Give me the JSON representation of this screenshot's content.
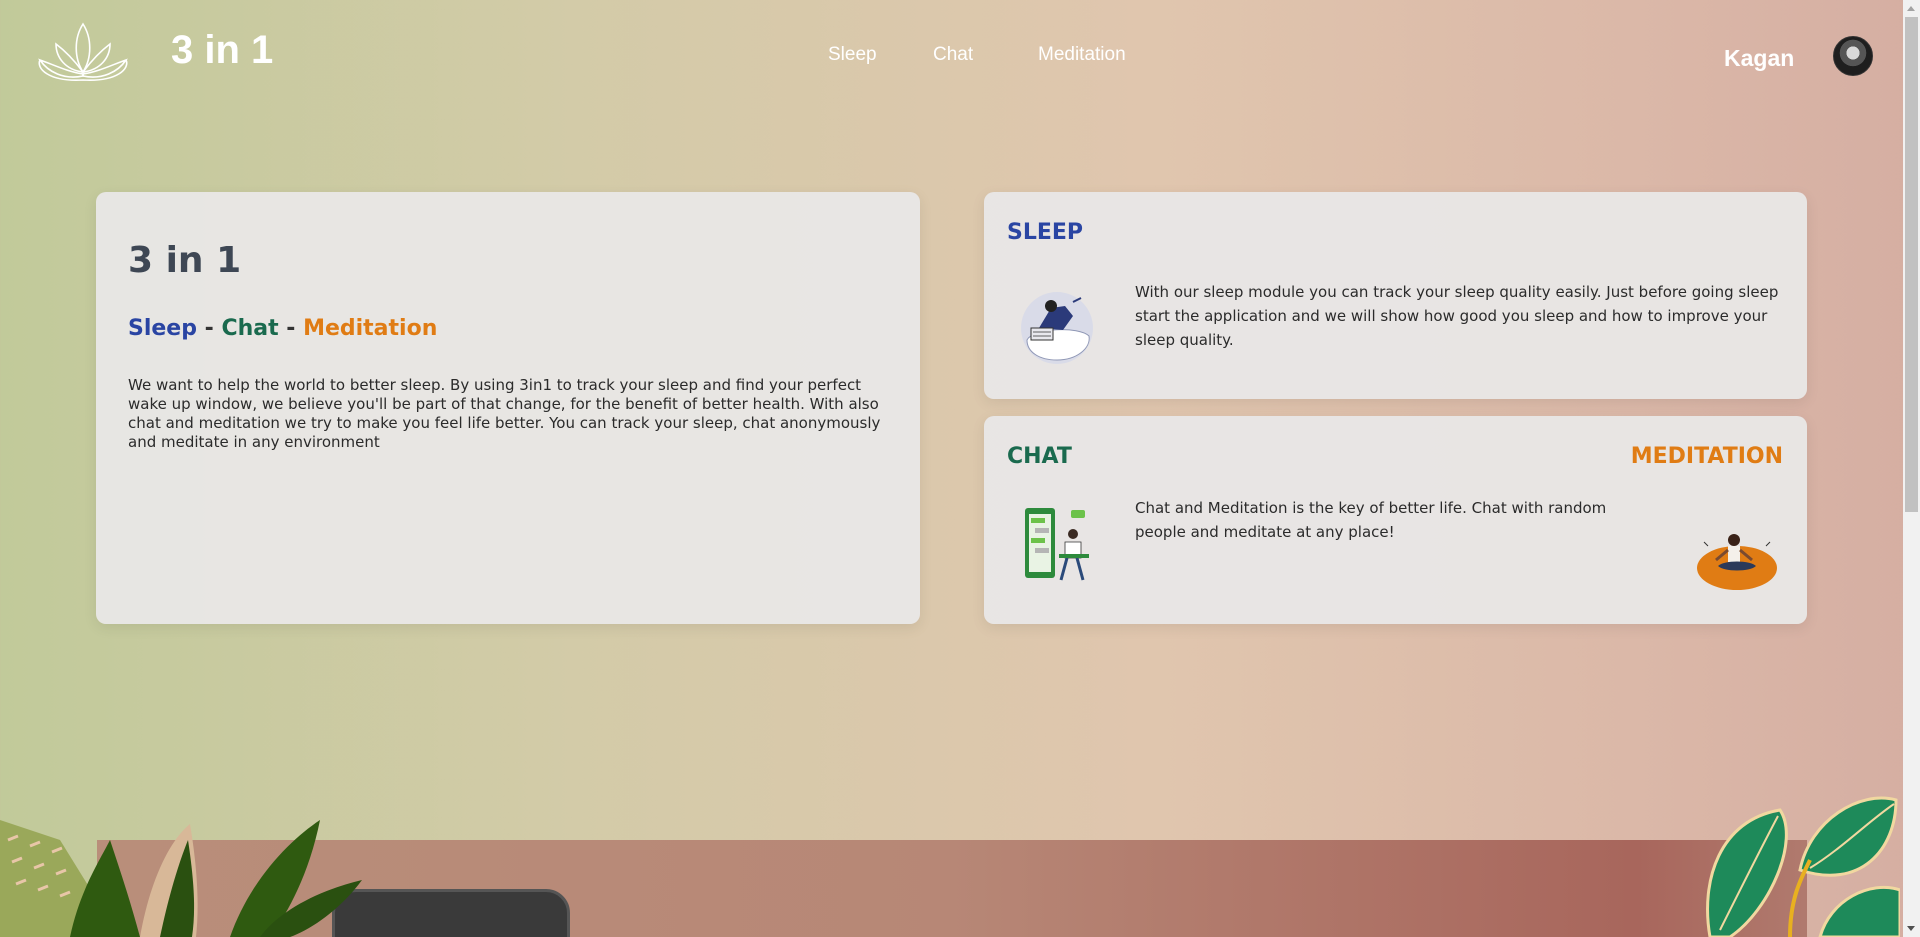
{
  "header": {
    "brand": "3 in 1",
    "nav": {
      "sleep": "Sleep",
      "chat": "Chat",
      "meditation": "Meditation"
    },
    "user_name": "Kagan"
  },
  "intro_card": {
    "title": "3 in 1",
    "subtitle": {
      "sleep": "Sleep",
      "sep1": " - ",
      "chat": "Chat",
      "sep2": " - ",
      "meditation": "Meditation"
    },
    "description": "We want to help the world to better sleep. By using 3in1 to track your sleep and find your perfect wake up window, we believe you'll be part of that change, for the benefit of better health. With also chat and meditation we try to make you feel life better. You can track your sleep, chat anonymously and meditate in any environment"
  },
  "sleep_card": {
    "heading": "SLEEP",
    "description": "With our sleep module you can track your sleep quality easily. Just before going sleep start the application and we will show how good you sleep and how to improve your sleep quality."
  },
  "chat_card": {
    "heading_chat": "CHAT",
    "heading_meditation": "MEDITATION",
    "description": "Chat and Meditation is the key of better life. Chat with random people and meditate at any place!"
  },
  "colors": {
    "sleep": "#2a45a3",
    "chat": "#1a6a4e",
    "meditation": "#e07c14",
    "title": "#3e4754"
  },
  "icons": {
    "logo": "lotus-icon",
    "avatar": "user-avatar",
    "sleep_illustration": "sleeping-person-illustration",
    "chat_illustration": "phone-chat-illustration",
    "meditation_illustration": "meditating-person-illustration"
  }
}
